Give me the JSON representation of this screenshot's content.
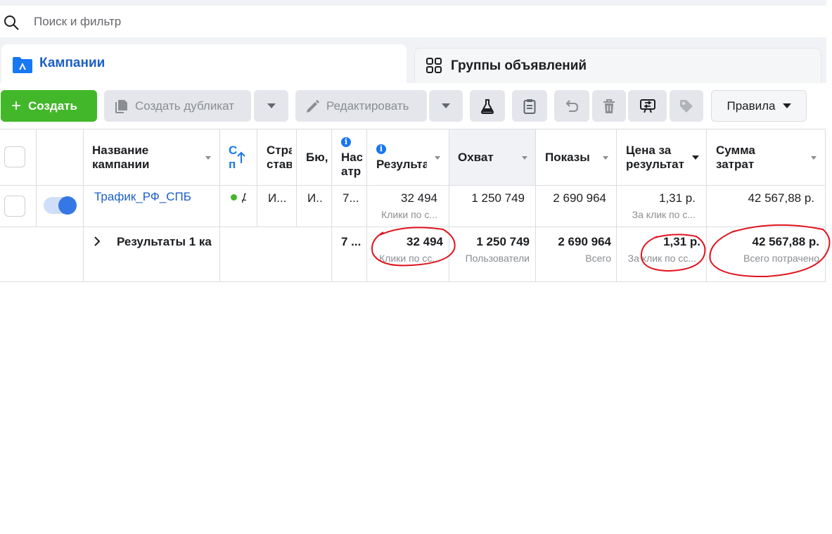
{
  "search": {
    "placeholder": "Поиск и фильтр"
  },
  "tabs": {
    "campaigns": "Кампании",
    "adsets": "Группы объявлений"
  },
  "toolbar": {
    "create": "Создать",
    "duplicate": "Создать дубликат",
    "edit": "Редактировать",
    "rules": "Правила"
  },
  "table": {
    "headers": {
      "name_line1": "Название",
      "name_line2": "кампании",
      "delivery_line1": "С",
      "delivery_line2": "п",
      "strategy_line1": "Стра",
      "strategy_line2": "став",
      "budget": "Бю,",
      "attribution_line1": "Нас",
      "attribution_line2": "атр",
      "results": "Результа",
      "reach": "Охват",
      "impressions": "Показы",
      "cpr_line1": "Цена за",
      "cpr_line2": "результат",
      "spent_line1": "Сумма",
      "spent_line2": "затрат"
    },
    "row": {
      "name": "Трафик_РФ_СПБ",
      "delivery": "Д",
      "strategy": "И...",
      "budget": "И..",
      "attribution": "7...",
      "results": "32 494",
      "results_sub": "Клики по с...",
      "reach": "1 250 749",
      "impressions": "2 690 964",
      "cpr": "1,31 р.",
      "cpr_sub": "За клик по с...",
      "spent": "42 567,88 р."
    },
    "summary": {
      "label": "Результаты 1 ка",
      "attribution": "7 ...",
      "results": "32 494",
      "results_sub": "Клики по сс...",
      "reach": "1 250 749",
      "reach_sub": "Пользователи",
      "impressions": "2 690 964",
      "impressions_sub": "Всего",
      "cpr": "1,31 р.",
      "cpr_sub": "За клик по сс...",
      "spent": "42 567,88 р.",
      "spent_sub": "Всего потрачено"
    }
  },
  "colors": {
    "create_green": "#42b72a",
    "link_blue": "#1b5fc6",
    "annotation_red": "#e0141e"
  }
}
